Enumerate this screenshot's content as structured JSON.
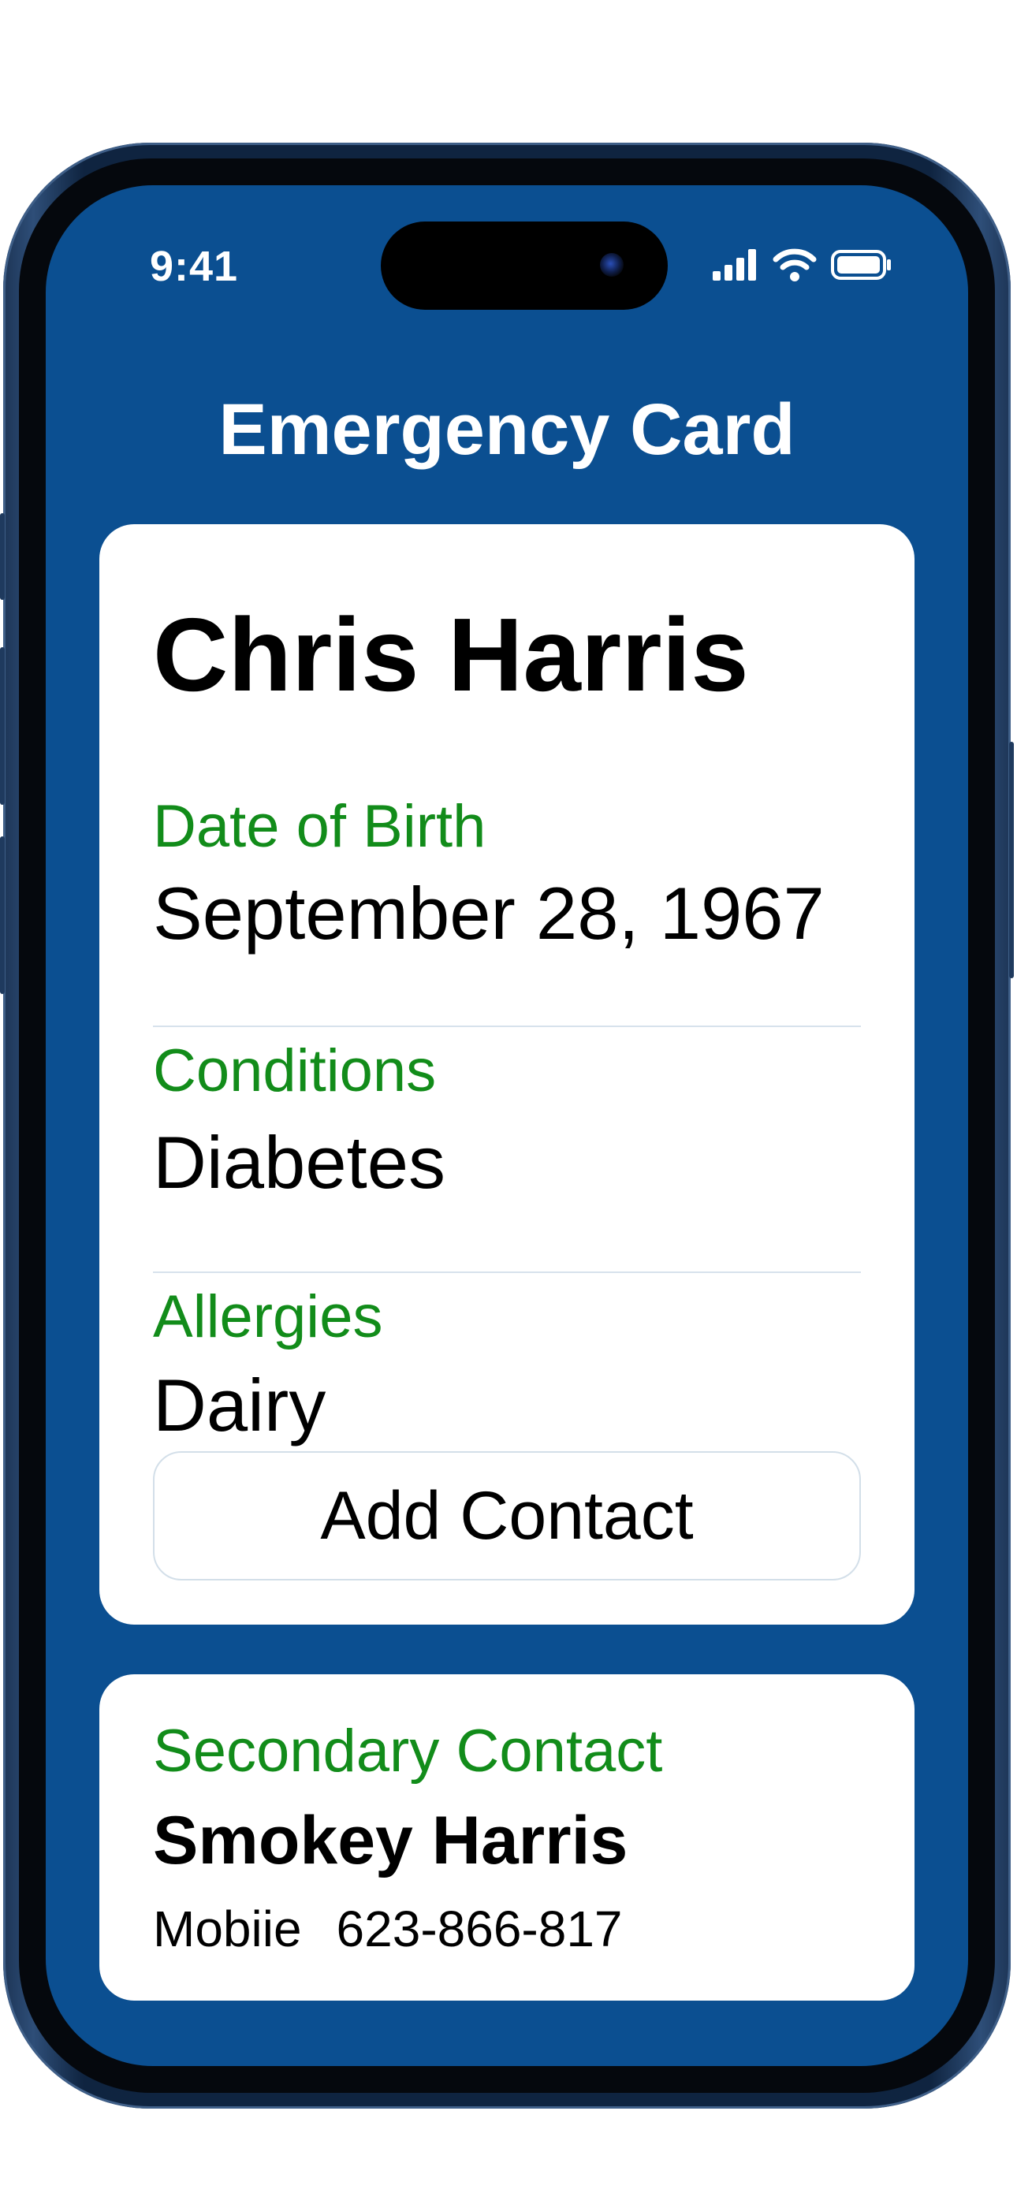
{
  "status_bar": {
    "time": "9:41",
    "icons": [
      "cellular-signal-icon",
      "wifi-icon",
      "battery-icon"
    ]
  },
  "colors": {
    "screen_background": "#0b4f91",
    "card_background": "#ffffff",
    "label_green": "#128c1a",
    "divider": "#d7e2ec"
  },
  "header": {
    "title": "Emergency Card"
  },
  "profile": {
    "name": "Chris Harris",
    "fields": [
      {
        "label": "Date of Birth",
        "value": "September 28, 1967"
      },
      {
        "label": "Conditions",
        "value": "Diabetes"
      },
      {
        "label": "Allergies",
        "value": "Dairy"
      }
    ],
    "add_contact_label": "Add Contact"
  },
  "secondary_contact": {
    "label": "Secondary Contact",
    "name": "Smokey Harris",
    "phone_type": "Mobiie",
    "phone_number": "623-866-817"
  }
}
